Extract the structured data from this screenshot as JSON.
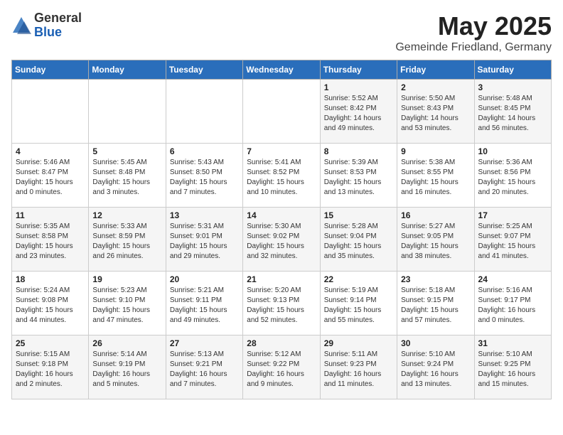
{
  "logo": {
    "general": "General",
    "blue": "Blue"
  },
  "title": "May 2025",
  "location": "Gemeinde Friedland, Germany",
  "days_of_week": [
    "Sunday",
    "Monday",
    "Tuesday",
    "Wednesday",
    "Thursday",
    "Friday",
    "Saturday"
  ],
  "weeks": [
    [
      {
        "day": "",
        "detail": ""
      },
      {
        "day": "",
        "detail": ""
      },
      {
        "day": "",
        "detail": ""
      },
      {
        "day": "",
        "detail": ""
      },
      {
        "day": "1",
        "detail": "Sunrise: 5:52 AM\nSunset: 8:42 PM\nDaylight: 14 hours\nand 49 minutes."
      },
      {
        "day": "2",
        "detail": "Sunrise: 5:50 AM\nSunset: 8:43 PM\nDaylight: 14 hours\nand 53 minutes."
      },
      {
        "day": "3",
        "detail": "Sunrise: 5:48 AM\nSunset: 8:45 PM\nDaylight: 14 hours\nand 56 minutes."
      }
    ],
    [
      {
        "day": "4",
        "detail": "Sunrise: 5:46 AM\nSunset: 8:47 PM\nDaylight: 15 hours\nand 0 minutes."
      },
      {
        "day": "5",
        "detail": "Sunrise: 5:45 AM\nSunset: 8:48 PM\nDaylight: 15 hours\nand 3 minutes."
      },
      {
        "day": "6",
        "detail": "Sunrise: 5:43 AM\nSunset: 8:50 PM\nDaylight: 15 hours\nand 7 minutes."
      },
      {
        "day": "7",
        "detail": "Sunrise: 5:41 AM\nSunset: 8:52 PM\nDaylight: 15 hours\nand 10 minutes."
      },
      {
        "day": "8",
        "detail": "Sunrise: 5:39 AM\nSunset: 8:53 PM\nDaylight: 15 hours\nand 13 minutes."
      },
      {
        "day": "9",
        "detail": "Sunrise: 5:38 AM\nSunset: 8:55 PM\nDaylight: 15 hours\nand 16 minutes."
      },
      {
        "day": "10",
        "detail": "Sunrise: 5:36 AM\nSunset: 8:56 PM\nDaylight: 15 hours\nand 20 minutes."
      }
    ],
    [
      {
        "day": "11",
        "detail": "Sunrise: 5:35 AM\nSunset: 8:58 PM\nDaylight: 15 hours\nand 23 minutes."
      },
      {
        "day": "12",
        "detail": "Sunrise: 5:33 AM\nSunset: 8:59 PM\nDaylight: 15 hours\nand 26 minutes."
      },
      {
        "day": "13",
        "detail": "Sunrise: 5:31 AM\nSunset: 9:01 PM\nDaylight: 15 hours\nand 29 minutes."
      },
      {
        "day": "14",
        "detail": "Sunrise: 5:30 AM\nSunset: 9:02 PM\nDaylight: 15 hours\nand 32 minutes."
      },
      {
        "day": "15",
        "detail": "Sunrise: 5:28 AM\nSunset: 9:04 PM\nDaylight: 15 hours\nand 35 minutes."
      },
      {
        "day": "16",
        "detail": "Sunrise: 5:27 AM\nSunset: 9:05 PM\nDaylight: 15 hours\nand 38 minutes."
      },
      {
        "day": "17",
        "detail": "Sunrise: 5:25 AM\nSunset: 9:07 PM\nDaylight: 15 hours\nand 41 minutes."
      }
    ],
    [
      {
        "day": "18",
        "detail": "Sunrise: 5:24 AM\nSunset: 9:08 PM\nDaylight: 15 hours\nand 44 minutes."
      },
      {
        "day": "19",
        "detail": "Sunrise: 5:23 AM\nSunset: 9:10 PM\nDaylight: 15 hours\nand 47 minutes."
      },
      {
        "day": "20",
        "detail": "Sunrise: 5:21 AM\nSunset: 9:11 PM\nDaylight: 15 hours\nand 49 minutes."
      },
      {
        "day": "21",
        "detail": "Sunrise: 5:20 AM\nSunset: 9:13 PM\nDaylight: 15 hours\nand 52 minutes."
      },
      {
        "day": "22",
        "detail": "Sunrise: 5:19 AM\nSunset: 9:14 PM\nDaylight: 15 hours\nand 55 minutes."
      },
      {
        "day": "23",
        "detail": "Sunrise: 5:18 AM\nSunset: 9:15 PM\nDaylight: 15 hours\nand 57 minutes."
      },
      {
        "day": "24",
        "detail": "Sunrise: 5:16 AM\nSunset: 9:17 PM\nDaylight: 16 hours\nand 0 minutes."
      }
    ],
    [
      {
        "day": "25",
        "detail": "Sunrise: 5:15 AM\nSunset: 9:18 PM\nDaylight: 16 hours\nand 2 minutes."
      },
      {
        "day": "26",
        "detail": "Sunrise: 5:14 AM\nSunset: 9:19 PM\nDaylight: 16 hours\nand 5 minutes."
      },
      {
        "day": "27",
        "detail": "Sunrise: 5:13 AM\nSunset: 9:21 PM\nDaylight: 16 hours\nand 7 minutes."
      },
      {
        "day": "28",
        "detail": "Sunrise: 5:12 AM\nSunset: 9:22 PM\nDaylight: 16 hours\nand 9 minutes."
      },
      {
        "day": "29",
        "detail": "Sunrise: 5:11 AM\nSunset: 9:23 PM\nDaylight: 16 hours\nand 11 minutes."
      },
      {
        "day": "30",
        "detail": "Sunrise: 5:10 AM\nSunset: 9:24 PM\nDaylight: 16 hours\nand 13 minutes."
      },
      {
        "day": "31",
        "detail": "Sunrise: 5:10 AM\nSunset: 9:25 PM\nDaylight: 16 hours\nand 15 minutes."
      }
    ]
  ]
}
